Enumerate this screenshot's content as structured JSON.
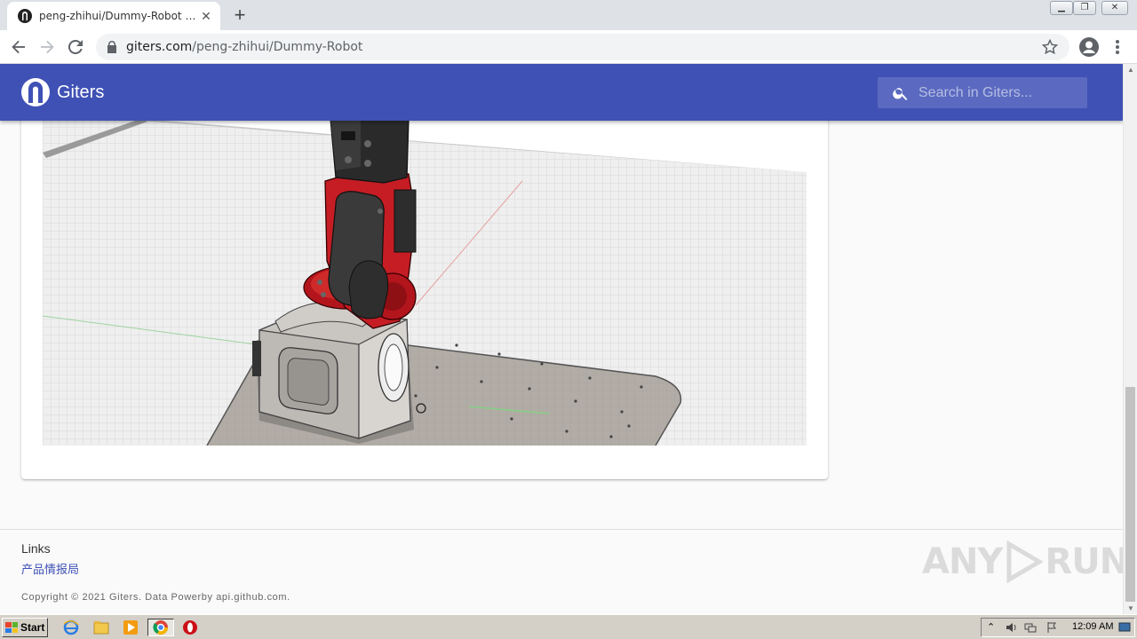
{
  "browser": {
    "tab_title": "peng-zhihui/Dummy-Robot - Giters",
    "new_tab_symbol": "+",
    "close_symbol": "✕",
    "url_host": "giters.com",
    "url_path": "/peng-zhihui/Dummy-Robot",
    "icons": [
      "back-icon",
      "forward-icon",
      "reload-icon",
      "lock-icon",
      "star-icon",
      "profile-icon",
      "menu-icon"
    ]
  },
  "site": {
    "name": "Giters",
    "search_placeholder": "Search in Giters...",
    "accent_color": "#3f51b5"
  },
  "content": {
    "image_subject": "Dummy-Robot 3D render"
  },
  "footer": {
    "links_title": "Links",
    "links": [
      "产品情报局"
    ],
    "copyright": "Copyright © 2021 Giters. Data Powerby api.github.com.",
    "watermark_left": "ANY",
    "watermark_right": "RUN"
  },
  "taskbar": {
    "start_label": "Start",
    "clock": "12:09 AM"
  }
}
